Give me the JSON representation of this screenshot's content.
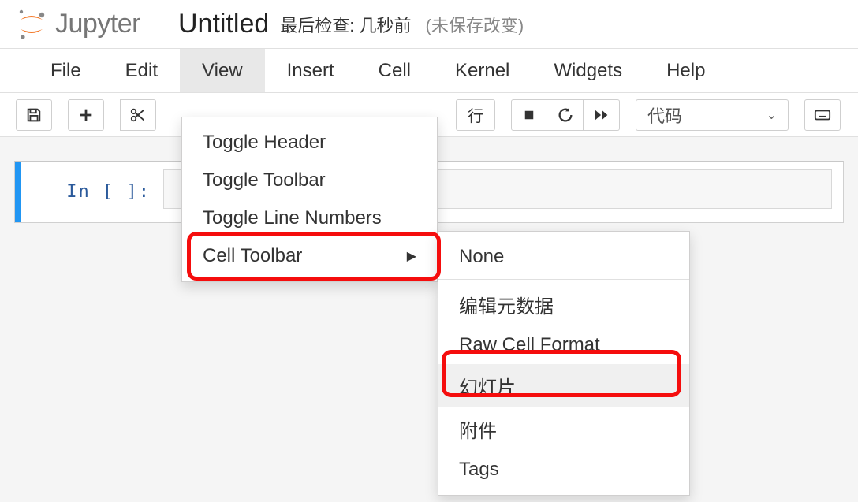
{
  "header": {
    "logo_text": "Jupyter",
    "title": "Untitled",
    "checkpoint": "最后检查: 几秒前",
    "autosave": "(未保存改变)"
  },
  "menubar": {
    "items": [
      "File",
      "Edit",
      "View",
      "Insert",
      "Cell",
      "Kernel",
      "Widgets",
      "Help"
    ],
    "active_index": 2
  },
  "view_menu": {
    "items": [
      {
        "label": "Toggle Header"
      },
      {
        "label": "Toggle Toolbar"
      },
      {
        "label": "Toggle Line Numbers"
      },
      {
        "label": "Cell Toolbar",
        "submenu": true,
        "highlighted": true
      }
    ]
  },
  "cell_toolbar_submenu": {
    "items": [
      {
        "label": "None"
      },
      {
        "label": "编辑元数据"
      },
      {
        "label": "Raw Cell Format"
      },
      {
        "label": "幻灯片",
        "hover": true,
        "highlighted": true
      },
      {
        "label": "附件"
      },
      {
        "label": "Tags"
      }
    ]
  },
  "toolbar": {
    "run_label": "运 行",
    "cell_type_selected": "代码",
    "icons": {
      "save": "save-icon",
      "add": "plus-icon",
      "cut": "scissors-icon",
      "stop": "stop-icon",
      "restart": "restart-icon",
      "forward": "fast-forward-icon",
      "keyboard": "keyboard-icon"
    }
  },
  "cell": {
    "prompt": "In [ ]:"
  },
  "colors": {
    "accent": "#f37726",
    "highlight_border": "#f50d0d",
    "selected": "#2196f3"
  }
}
